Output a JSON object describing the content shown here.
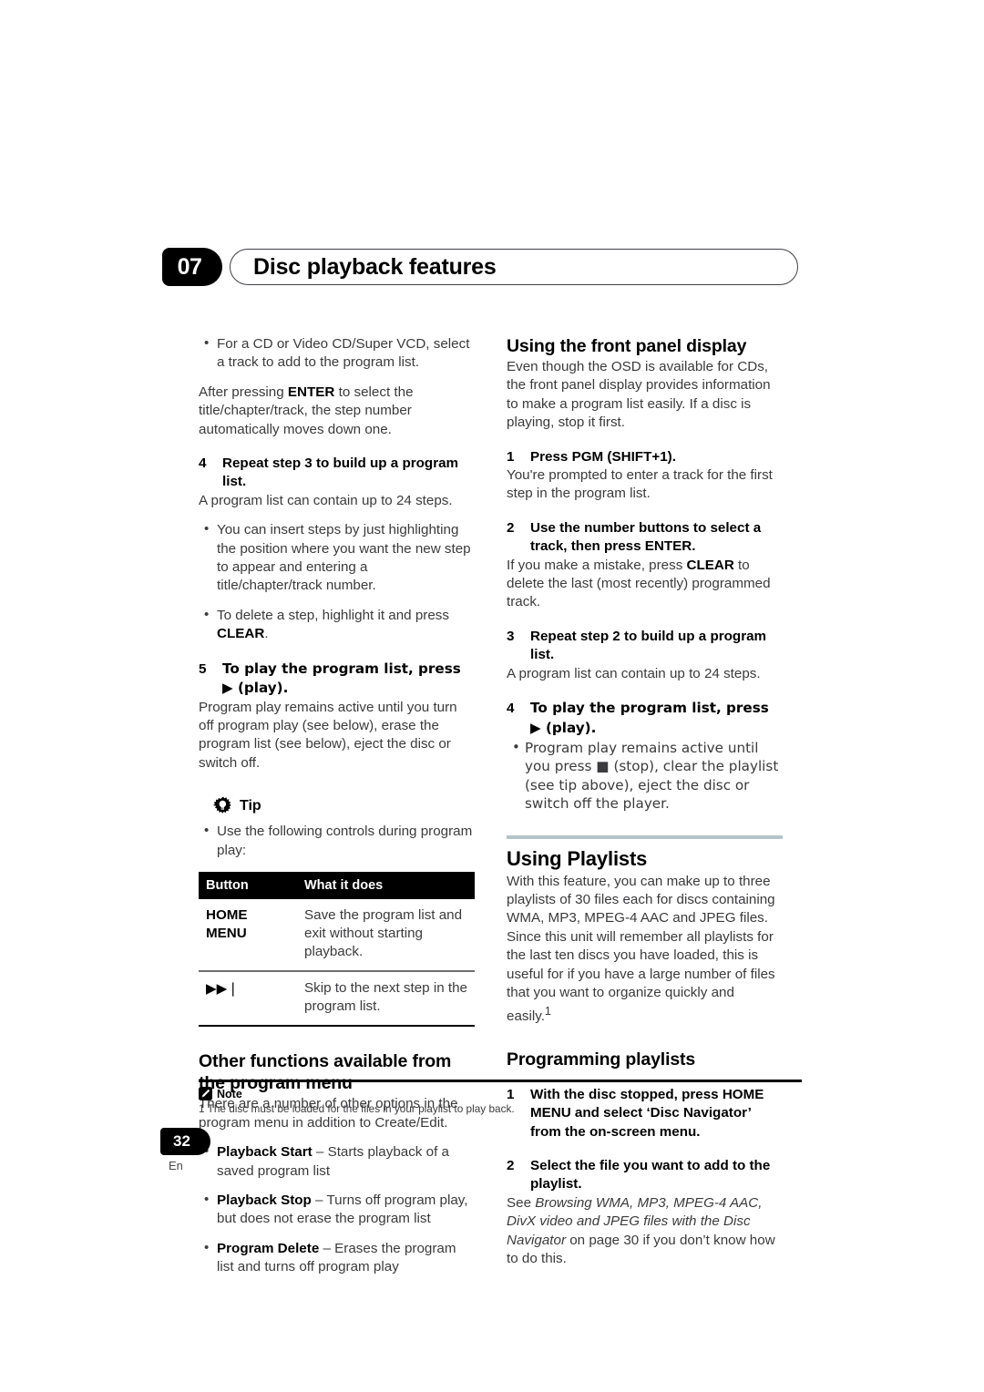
{
  "header": {
    "chapter_number": "07",
    "chapter_title": "Disc playback features"
  },
  "left_column": {
    "bullet_intro": "For a CD or Video CD/Super VCD, select a track to add to the program list.",
    "after_enter_para_1": "After pressing ",
    "after_enter_bold": "ENTER",
    "after_enter_para_2": " to select the title/chapter/track, the step number automatically moves down one.",
    "step4_num": "4",
    "step4_head": "Repeat step 3 to build up a program list.",
    "step4_body": "A program list can contain up to 24 steps.",
    "step4_bullet_1": "You can insert steps by just highlighting the position where you want the new step to appear and entering a title/chapter/track number.",
    "step4_bullet_2_pre": "To delete a step, highlight it and press ",
    "step4_bullet_2_bold": "CLEAR",
    "step4_bullet_2_post": ".",
    "step5_num": "5",
    "step5_head": "To play the program list, press ▶ (play).",
    "step5_body": "Program play remains active until you turn off program play (see below), erase the program list (see below), eject the disc or switch off.",
    "tip": {
      "icon": "lightbulb-icon",
      "label": "Tip",
      "bullet": "Use the following controls during program play:"
    },
    "table": {
      "columns": [
        "Button",
        "What it does"
      ],
      "rows": [
        {
          "button": "HOME\nMENU",
          "button_line1": "HOME",
          "button_line2": "MENU",
          "what": "Save the program list and exit without starting playback."
        },
        {
          "button": "▶▶❘",
          "what": "Skip to the next step in the program list."
        }
      ]
    },
    "other_functions": {
      "heading": "Other functions available from the program menu",
      "intro": "There are a number of other options in the program menu in addition to Create/Edit.",
      "items": [
        {
          "term": "Playback Start",
          "desc": " – Starts playback of a saved program list"
        },
        {
          "term": "Playback Stop",
          "desc": " – Turns off program play, but does not erase the program list"
        },
        {
          "term": "Program Delete",
          "desc": " – Erases the program list and turns off program play"
        }
      ]
    }
  },
  "right_column": {
    "front_panel": {
      "heading": "Using the front panel display",
      "intro": "Even though the OSD is available for CDs, the front panel display provides information to make a program list easily. If a disc is playing, stop it first.",
      "step1_num": "1",
      "step1_head": "Press PGM (SHIFT+1).",
      "step1_body": "You're prompted to enter a track for the first step in the program list.",
      "step2_num": "2",
      "step2_head": "Use the number buttons to select a track, then press ENTER.",
      "step2_body_pre": "If you make a mistake, press ",
      "step2_body_bold": "CLEAR",
      "step2_body_post": " to delete the last (most recently) programmed track.",
      "step3_num": "3",
      "step3_head": "Repeat step 2 to build up a program list.",
      "step3_body": "A program list can contain up to 24 steps.",
      "step4_num": "4",
      "step4_head": "To play the program list, press ▶ (play).",
      "step4_bullet": "Program play remains active until you press ■ (stop), clear the playlist (see tip above), eject the disc or switch off the player."
    },
    "playlists": {
      "heading": "Using Playlists",
      "body": "With this feature, you can make up to three playlists of 30 files each for discs containing WMA, MP3, MPEG-4 AAC and JPEG files. Since this unit will remember all playlists for the last ten discs you have loaded, this is useful for if you have a large number of  files that you want to organize quickly and easily.",
      "footnote_marker": "1"
    },
    "programming": {
      "heading": "Programming playlists",
      "step1_num": "1",
      "step1_head": "With the disc stopped, press HOME MENU and select ‘Disc Navigator’ from the on-screen menu.",
      "step2_num": "2",
      "step2_head": "Select the file you want to add to the playlist.",
      "step2_body_pre": "See ",
      "step2_body_italic": "Browsing WMA, MP3, MPEG-4 AAC, DivX video and JPEG files with the Disc Navigator",
      "step2_body_post": " on page 30 if you don’t know how to do this."
    }
  },
  "footer": {
    "note_icon": "pencil-icon",
    "note_label": "Note",
    "note_text": "1 The disc must be loaded for the files in your playlist to play back.",
    "page_number": "32",
    "language": "En"
  },
  "colors": {
    "accent_rule": "#b5c4c9",
    "black": "#000000",
    "body_text": "#3b3b3d"
  }
}
